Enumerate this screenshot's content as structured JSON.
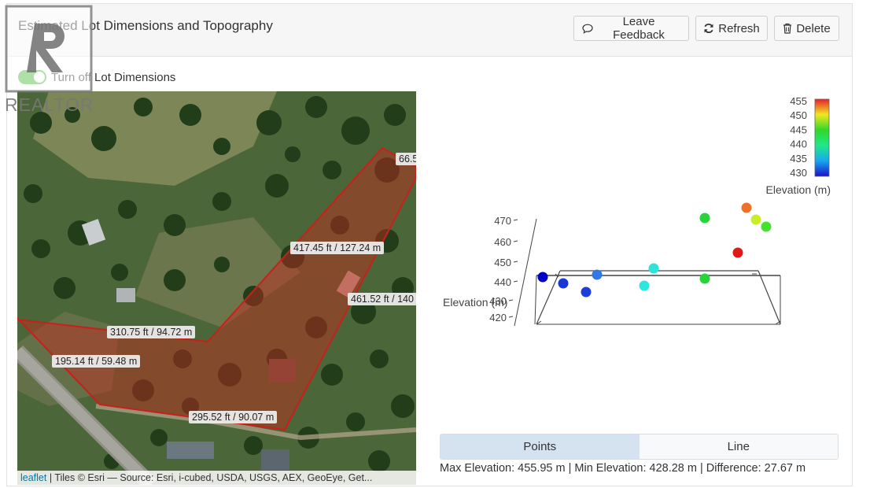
{
  "header": {
    "title": "Estimated Lot Dimensions and Topography",
    "feedback_label": "Leave Feedback",
    "refresh_label": "Refresh",
    "delete_label": "Delete"
  },
  "toggle": {
    "label": "Turn off Lot Dimensions",
    "on": true
  },
  "logo": {
    "text": "REALTOR"
  },
  "map": {
    "labels": [
      "66.5",
      "417.45 ft / 127.24 m",
      "461.52 ft / 140",
      "310.75 ft / 94.72 m",
      "195.14 ft / 59.48 m",
      "295.52 ft / 90.07 m"
    ],
    "attribution_link": "leaflet",
    "attribution_text": " | Tiles © Esri — Source: Esri, i-cubed, USDA, USGS, AEX, GeoEye, Get..."
  },
  "chart_data": {
    "type": "scatter",
    "zlabel": "Elevation (m)",
    "z_ticks": [
      "470",
      "460",
      "450",
      "440",
      "430",
      "420"
    ],
    "colorbar": {
      "label": "Elevation (m)",
      "ticks": [
        "455",
        "450",
        "445",
        "440",
        "435",
        "430"
      ],
      "range": [
        428.28,
        455.95
      ]
    },
    "points": [
      {
        "elevation": 428.5,
        "color": "#0000c8"
      },
      {
        "elevation": 431,
        "color": "#1a38d6"
      },
      {
        "elevation": 430,
        "color": "#1c3fd8"
      },
      {
        "elevation": 433,
        "color": "#2f78e6"
      },
      {
        "elevation": 438,
        "color": "#2ee6e0"
      },
      {
        "elevation": 439,
        "color": "#2fe3dc"
      },
      {
        "elevation": 441,
        "color": "#27d43c"
      },
      {
        "elevation": 447,
        "color": "#27d43c"
      },
      {
        "elevation": 455.5,
        "color": "#e01818"
      },
      {
        "elevation": 453,
        "color": "#f07028"
      },
      {
        "elevation": 451,
        "color": "#c8ee2a"
      },
      {
        "elevation": 449,
        "color": "#48e030"
      }
    ]
  },
  "tabs": [
    {
      "label": "Points",
      "active": true
    },
    {
      "label": "Line",
      "active": false
    }
  ],
  "stats": {
    "text": "Max Elevation: 455.95 m | Min Elevation: 428.28 m | Difference: 27.67 m"
  }
}
